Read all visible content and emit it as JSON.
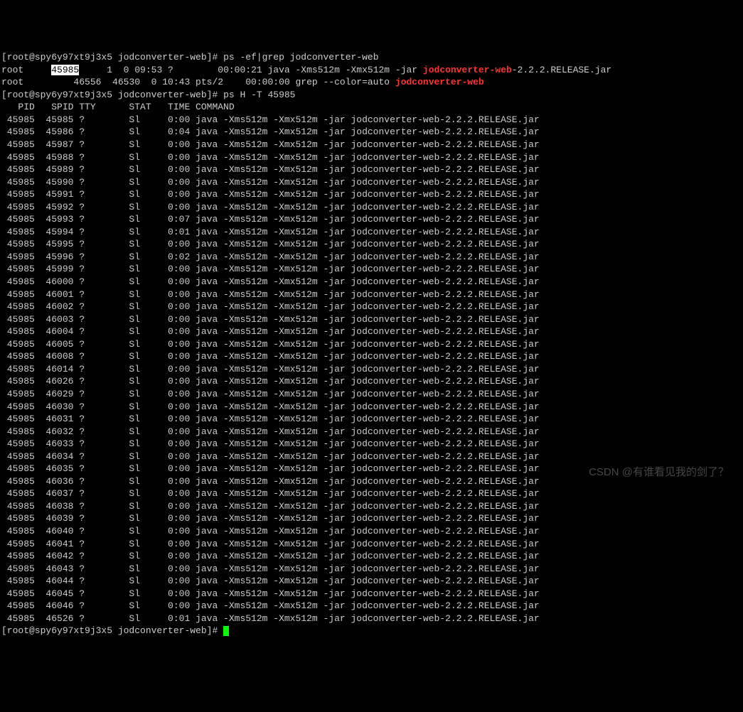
{
  "prompt1": {
    "text": "[root@spy6y97xt9j3x5 jodconverter-web]# ",
    "cmd": "ps -ef|grep jodconverter-web"
  },
  "ps_ef": [
    {
      "user": "root",
      "pid_hl": "45985",
      "rest1": "     1  0 09:53 ?        00:00:21 java -Xms512m -Xmx512m -jar ",
      "match": "jodconverter-web",
      "rest2": "-2.2.2.RELEASE.jar"
    },
    {
      "user": "root",
      "pid": "     46556  46530  0 10:43 pts/2    00:00:00 grep --color=auto ",
      "match": "jodconverter-web",
      "rest2": ""
    }
  ],
  "prompt2": {
    "text": "[root@spy6y97xt9j3x5 jodconverter-web]# ",
    "cmd": "ps H -T 45985"
  },
  "header": "   PID   SPID TTY      STAT   TIME COMMAND",
  "java_cmd": "java -Xms512m -Xmx512m -jar jodconverter-web-2.2.2.RELEASE.jar",
  "threads": [
    {
      "pid": "45985",
      "spid": "45985",
      "tty": "?",
      "stat": "Sl",
      "time": "0:00"
    },
    {
      "pid": "45985",
      "spid": "45986",
      "tty": "?",
      "stat": "Sl",
      "time": "0:04"
    },
    {
      "pid": "45985",
      "spid": "45987",
      "tty": "?",
      "stat": "Sl",
      "time": "0:00"
    },
    {
      "pid": "45985",
      "spid": "45988",
      "tty": "?",
      "stat": "Sl",
      "time": "0:00"
    },
    {
      "pid": "45985",
      "spid": "45989",
      "tty": "?",
      "stat": "Sl",
      "time": "0:00"
    },
    {
      "pid": "45985",
      "spid": "45990",
      "tty": "?",
      "stat": "Sl",
      "time": "0:00"
    },
    {
      "pid": "45985",
      "spid": "45991",
      "tty": "?",
      "stat": "Sl",
      "time": "0:00"
    },
    {
      "pid": "45985",
      "spid": "45992",
      "tty": "?",
      "stat": "Sl",
      "time": "0:00"
    },
    {
      "pid": "45985",
      "spid": "45993",
      "tty": "?",
      "stat": "Sl",
      "time": "0:07"
    },
    {
      "pid": "45985",
      "spid": "45994",
      "tty": "?",
      "stat": "Sl",
      "time": "0:01"
    },
    {
      "pid": "45985",
      "spid": "45995",
      "tty": "?",
      "stat": "Sl",
      "time": "0:00"
    },
    {
      "pid": "45985",
      "spid": "45996",
      "tty": "?",
      "stat": "Sl",
      "time": "0:02"
    },
    {
      "pid": "45985",
      "spid": "45999",
      "tty": "?",
      "stat": "Sl",
      "time": "0:00"
    },
    {
      "pid": "45985",
      "spid": "46000",
      "tty": "?",
      "stat": "Sl",
      "time": "0:00"
    },
    {
      "pid": "45985",
      "spid": "46001",
      "tty": "?",
      "stat": "Sl",
      "time": "0:00"
    },
    {
      "pid": "45985",
      "spid": "46002",
      "tty": "?",
      "stat": "Sl",
      "time": "0:00"
    },
    {
      "pid": "45985",
      "spid": "46003",
      "tty": "?",
      "stat": "Sl",
      "time": "0:00"
    },
    {
      "pid": "45985",
      "spid": "46004",
      "tty": "?",
      "stat": "Sl",
      "time": "0:00"
    },
    {
      "pid": "45985",
      "spid": "46005",
      "tty": "?",
      "stat": "Sl",
      "time": "0:00"
    },
    {
      "pid": "45985",
      "spid": "46008",
      "tty": "?",
      "stat": "Sl",
      "time": "0:00"
    },
    {
      "pid": "45985",
      "spid": "46014",
      "tty": "?",
      "stat": "Sl",
      "time": "0:00"
    },
    {
      "pid": "45985",
      "spid": "46026",
      "tty": "?",
      "stat": "Sl",
      "time": "0:00"
    },
    {
      "pid": "45985",
      "spid": "46029",
      "tty": "?",
      "stat": "Sl",
      "time": "0:00"
    },
    {
      "pid": "45985",
      "spid": "46030",
      "tty": "?",
      "stat": "Sl",
      "time": "0:00"
    },
    {
      "pid": "45985",
      "spid": "46031",
      "tty": "?",
      "stat": "Sl",
      "time": "0:00"
    },
    {
      "pid": "45985",
      "spid": "46032",
      "tty": "?",
      "stat": "Sl",
      "time": "0:00"
    },
    {
      "pid": "45985",
      "spid": "46033",
      "tty": "?",
      "stat": "Sl",
      "time": "0:00"
    },
    {
      "pid": "45985",
      "spid": "46034",
      "tty": "?",
      "stat": "Sl",
      "time": "0:00"
    },
    {
      "pid": "45985",
      "spid": "46035",
      "tty": "?",
      "stat": "Sl",
      "time": "0:00"
    },
    {
      "pid": "45985",
      "spid": "46036",
      "tty": "?",
      "stat": "Sl",
      "time": "0:00"
    },
    {
      "pid": "45985",
      "spid": "46037",
      "tty": "?",
      "stat": "Sl",
      "time": "0:00"
    },
    {
      "pid": "45985",
      "spid": "46038",
      "tty": "?",
      "stat": "Sl",
      "time": "0:00"
    },
    {
      "pid": "45985",
      "spid": "46039",
      "tty": "?",
      "stat": "Sl",
      "time": "0:00"
    },
    {
      "pid": "45985",
      "spid": "46040",
      "tty": "?",
      "stat": "Sl",
      "time": "0:00"
    },
    {
      "pid": "45985",
      "spid": "46041",
      "tty": "?",
      "stat": "Sl",
      "time": "0:00"
    },
    {
      "pid": "45985",
      "spid": "46042",
      "tty": "?",
      "stat": "Sl",
      "time": "0:00"
    },
    {
      "pid": "45985",
      "spid": "46043",
      "tty": "?",
      "stat": "Sl",
      "time": "0:00"
    },
    {
      "pid": "45985",
      "spid": "46044",
      "tty": "?",
      "stat": "Sl",
      "time": "0:00"
    },
    {
      "pid": "45985",
      "spid": "46045",
      "tty": "?",
      "stat": "Sl",
      "time": "0:00"
    },
    {
      "pid": "45985",
      "spid": "46046",
      "tty": "?",
      "stat": "Sl",
      "time": "0:00"
    },
    {
      "pid": "45985",
      "spid": "46526",
      "tty": "?",
      "stat": "Sl",
      "time": "0:01"
    }
  ],
  "prompt3": {
    "text": "[root@spy6y97xt9j3x5 jodconverter-web]# "
  },
  "watermark": "CSDN @有谁看见我的剑了？"
}
